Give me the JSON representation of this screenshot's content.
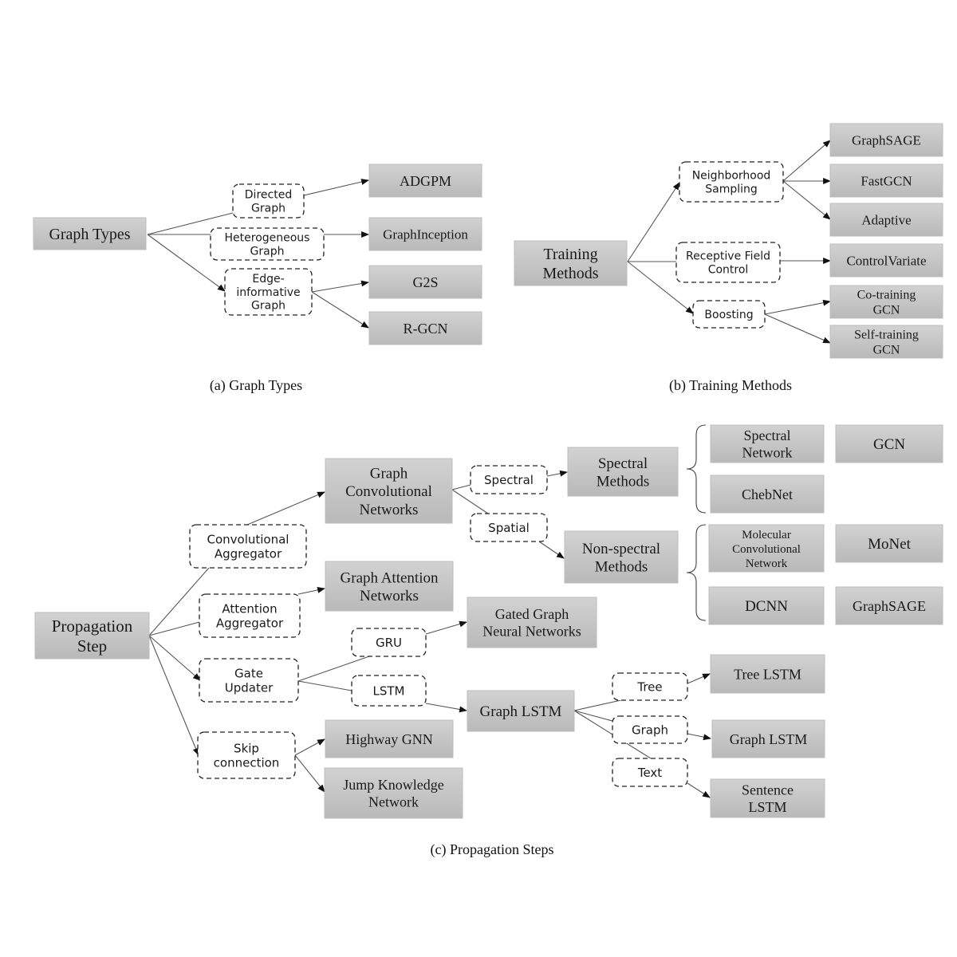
{
  "figure_a": {
    "caption": "(a) Graph Types",
    "root": "Graph Types",
    "categories": [
      "Directed Graph",
      "Heterogeneous Graph",
      "Edge-informative Graph"
    ],
    "methods": [
      "ADGPM",
      "GraphInception",
      "G2S",
      "R-GCN"
    ]
  },
  "figure_b": {
    "caption": "(b) Training Methods",
    "root": "Training Methods",
    "categories": [
      "Neighborhood Sampling",
      "Receptive Field Control",
      "Boosting"
    ],
    "methods": [
      "GraphSAGE",
      "FastGCN",
      "Adaptive",
      "ControlVariate",
      "Co-training GCN",
      "Self-training GCN"
    ]
  },
  "figure_c": {
    "caption": "(c) Propagation Steps",
    "root": "Propagation Step",
    "aggregators": [
      "Convolutional Aggregator",
      "Attention Aggregator",
      "Gate Updater",
      "Skip connection"
    ],
    "sub_labels": [
      "Spectral",
      "Spatial",
      "GRU",
      "LSTM",
      "Tree",
      "Graph",
      "Text"
    ],
    "models": [
      "Graph Convolutional Networks",
      "Graph Attention Networks",
      "Gated Graph Neural Networks",
      "Graph LSTM",
      "Highway GNN",
      "Jump Knowledge Network",
      "Spectral Methods",
      "Non-spectral Methods",
      "Tree LSTM",
      "Graph LSTM",
      "Sentence LSTM"
    ],
    "spectral_methods": [
      "Spectral Network",
      "GCN",
      "ChebNet"
    ],
    "non_spectral_methods": [
      "Molecular Convolutional Network",
      "MoNet",
      "DCNN",
      "GraphSAGE"
    ]
  }
}
